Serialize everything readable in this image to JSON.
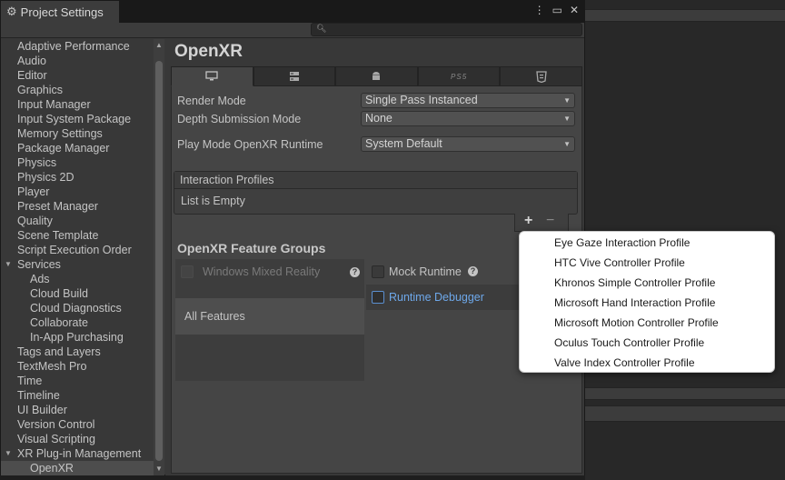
{
  "window": {
    "title": "Project Settings",
    "menu_icon": "kebab-menu-icon",
    "maximize_icon": "maximize-icon",
    "close_icon": "close-icon"
  },
  "search": {
    "placeholder": "",
    "icon": "search-icon"
  },
  "sidebar": {
    "items": [
      {
        "label": "Adaptive Performance"
      },
      {
        "label": "Audio"
      },
      {
        "label": "Editor"
      },
      {
        "label": "Graphics"
      },
      {
        "label": "Input Manager"
      },
      {
        "label": "Input System Package"
      },
      {
        "label": "Memory Settings"
      },
      {
        "label": "Package Manager"
      },
      {
        "label": "Physics"
      },
      {
        "label": "Physics 2D"
      },
      {
        "label": "Player"
      },
      {
        "label": "Preset Manager"
      },
      {
        "label": "Quality"
      },
      {
        "label": "Scene Template"
      },
      {
        "label": "Script Execution Order"
      },
      {
        "label": "Services",
        "expanded": true
      },
      {
        "label": "Ads"
      },
      {
        "label": "Cloud Build"
      },
      {
        "label": "Cloud Diagnostics"
      },
      {
        "label": "Collaborate"
      },
      {
        "label": "In-App Purchasing"
      },
      {
        "label": "Tags and Layers"
      },
      {
        "label": "TextMesh Pro"
      },
      {
        "label": "Time"
      },
      {
        "label": "Timeline"
      },
      {
        "label": "UI Builder"
      },
      {
        "label": "Version Control"
      },
      {
        "label": "Visual Scripting"
      },
      {
        "label": "XR Plug-in Management",
        "expanded": true
      },
      {
        "label": "OpenXR",
        "selected": true
      }
    ]
  },
  "main": {
    "title": "OpenXR",
    "platform_tabs": [
      {
        "icon": "desktop-icon",
        "active": true
      },
      {
        "icon": "server-icon"
      },
      {
        "icon": "android-icon"
      },
      {
        "icon": "ps5-icon",
        "label": "PS5"
      },
      {
        "icon": "html5-icon"
      }
    ],
    "render_mode": {
      "label": "Render Mode",
      "value": "Single Pass Instanced"
    },
    "depth_submission": {
      "label": "Depth Submission Mode",
      "value": "None"
    },
    "play_mode_runtime": {
      "label": "Play Mode OpenXR Runtime",
      "value": "System Default"
    },
    "interaction_profiles": {
      "header": "Interaction Profiles",
      "empty_text": "List is Empty",
      "add": "+",
      "remove": "−"
    },
    "feature_groups": {
      "title": "OpenXR Feature Groups",
      "groups": [
        {
          "label": "Windows Mixed Reality",
          "enabled": false
        },
        {
          "label": "All Features",
          "selected": true
        }
      ],
      "features": [
        {
          "label": "Mock Runtime",
          "checked": false
        },
        {
          "label": "Runtime Debugger",
          "checked": false
        }
      ],
      "help_glyph": "?"
    }
  },
  "popup": {
    "items": [
      "Eye Gaze Interaction Profile",
      "HTC Vive Controller Profile",
      "Khronos Simple Controller Profile",
      "Microsoft Hand Interaction Profile",
      "Microsoft Motion Controller Profile",
      "Oculus Touch Controller Profile",
      "Valve Index Controller Profile"
    ]
  },
  "colors": {
    "window_bg": "#383838",
    "panel_bg": "#454545",
    "text": "#c4c4c4",
    "link_blue": "#6ea8ea",
    "popup_bg": "#ffffff"
  }
}
